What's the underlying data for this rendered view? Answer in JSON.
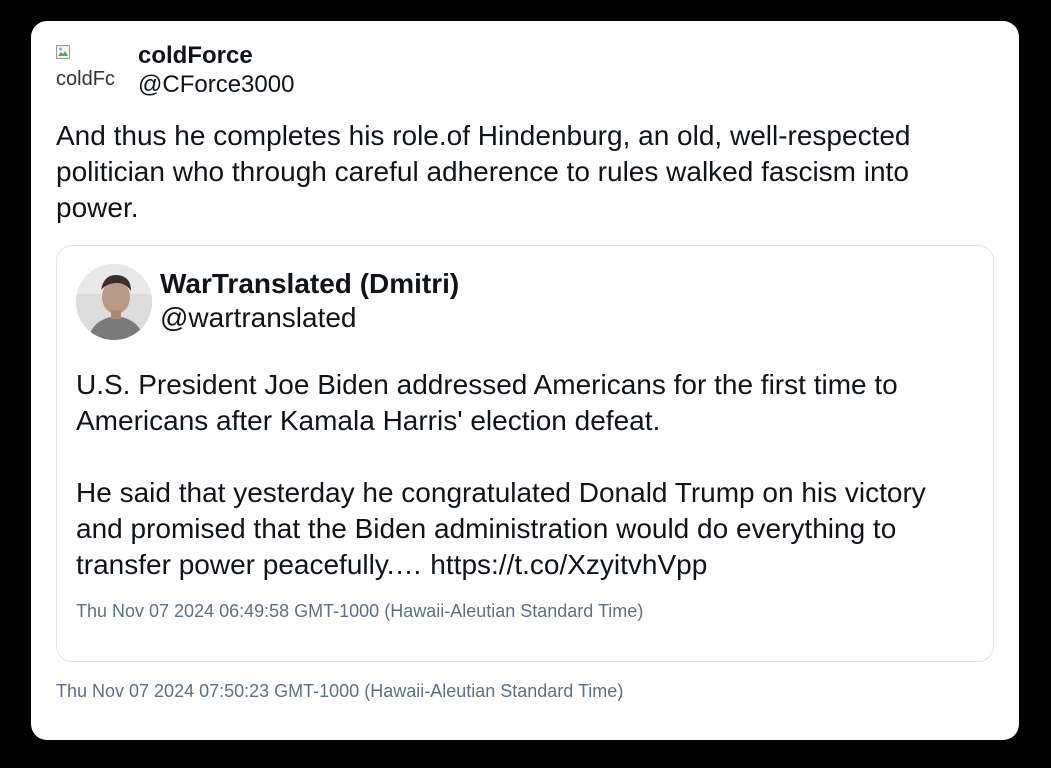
{
  "tweet": {
    "author": {
      "display_name": "coldForce",
      "handle": "@CForce3000",
      "avatar_alt": "coldFc"
    },
    "text": "And thus he completes his role.of Hindenburg, an old, well-respected politician who through careful adherence to rules walked fascism into power.",
    "timestamp": "Thu Nov 07 2024 07:50:23 GMT-1000 (Hawaii-Aleutian Standard Time)"
  },
  "quoted_tweet": {
    "author": {
      "display_name": "WarTranslated (Dmitri)",
      "handle": "@wartranslated"
    },
    "paragraph_1": "U.S. President Joe Biden addressed Americans for the first time to Americans after Kamala Harris' election defeat.",
    "paragraph_2": "He said that yesterday he congratulated Donald Trump on his victory and promised that the Biden administration would do everything to transfer power peacefully.… https://t.co/XzyitvhVpp",
    "timestamp": "Thu Nov 07 2024 06:49:58 GMT-1000 (Hawaii-Aleutian Standard Time)"
  },
  "icons": {
    "broken_image": "broken-image-icon",
    "avatar": "person-avatar"
  },
  "colors": {
    "background": "#000000",
    "card": "#ffffff",
    "text": "#0f1419",
    "muted": "#5b7083",
    "border": "#e1e4e8"
  }
}
